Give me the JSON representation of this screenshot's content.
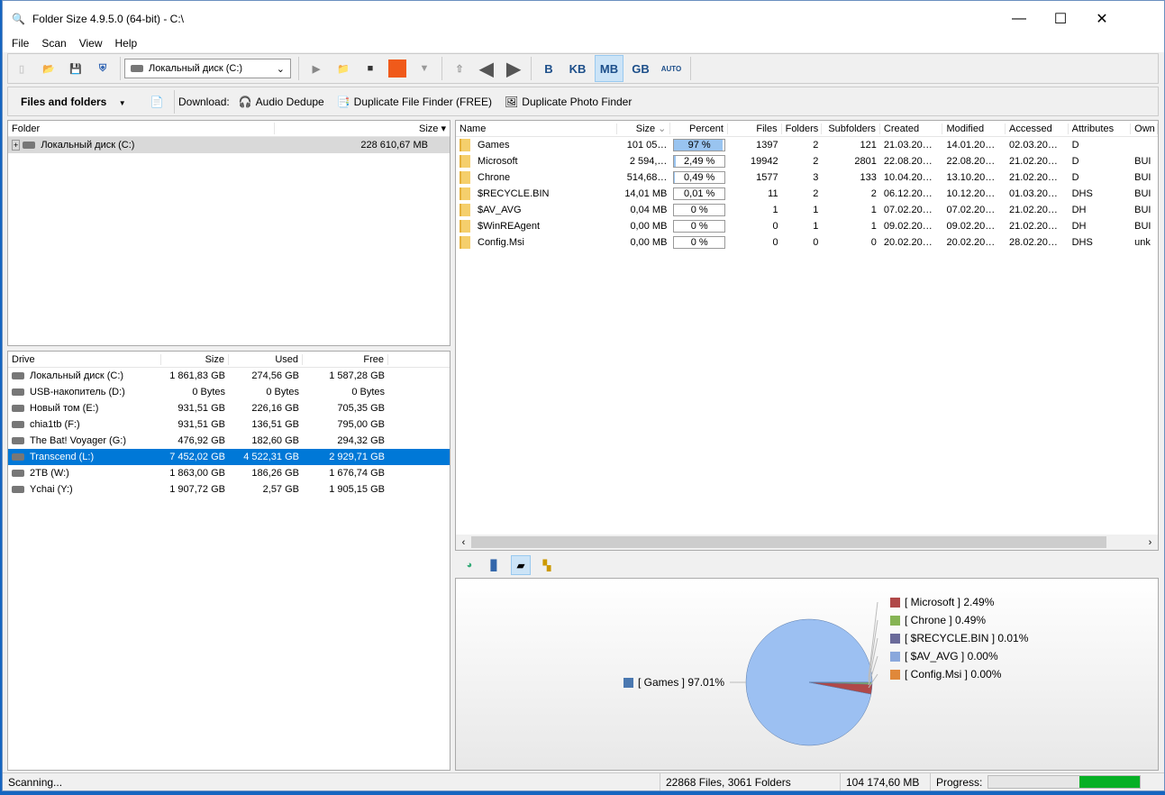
{
  "title": "Folder Size 4.9.5.0 (64-bit) - C:\\",
  "window_controls": {
    "min": "—",
    "max": "☐",
    "close": "✕"
  },
  "menu": [
    "File",
    "Scan",
    "View",
    "Help"
  ],
  "toolbar": {
    "drive_select": "Локальный диск (C:)",
    "units": [
      "B",
      "KB",
      "MB",
      "GB",
      "AUTO"
    ],
    "active_unit": "MB"
  },
  "toolbar2": {
    "view": "Files and folders",
    "download": "Download:",
    "links": [
      "Audio Dedupe",
      "Duplicate File Finder (FREE)",
      "Duplicate Photo Finder"
    ]
  },
  "tree": {
    "headers": [
      "Folder",
      "Size"
    ],
    "rows": [
      {
        "name": "Локальный диск (C:)",
        "size": "228 610,67 MB"
      }
    ]
  },
  "drives": {
    "headers": [
      "Drive",
      "Size",
      "Used",
      "Free"
    ],
    "rows": [
      [
        "Локальный диск (C:)",
        "1 861,83 GB",
        "274,56 GB",
        "1 587,28 GB"
      ],
      [
        "USB-накопитель (D:)",
        "0 Bytes",
        "0 Bytes",
        "0 Bytes"
      ],
      [
        "Новый том (E:)",
        "931,51 GB",
        "226,16 GB",
        "705,35 GB"
      ],
      [
        "chia1tb (F:)",
        "931,51 GB",
        "136,51 GB",
        "795,00 GB"
      ],
      [
        "The Bat! Voyager (G:)",
        "476,92 GB",
        "182,60 GB",
        "294,32 GB"
      ],
      [
        "Transcend (L:)",
        "7 452,02 GB",
        "4 522,31 GB",
        "2 929,71 GB"
      ],
      [
        "2TB (W:)",
        "1 863,00 GB",
        "186,26 GB",
        "1 676,74 GB"
      ],
      [
        "Ychai (Y:)",
        "1 907,72 GB",
        "2,57 GB",
        "1 905,15 GB"
      ]
    ],
    "selected": 5
  },
  "files": {
    "headers": [
      "Name",
      "Size",
      "Percent",
      "Files",
      "Folders",
      "Subfolders",
      "Created",
      "Modified",
      "Accessed",
      "Attributes",
      "Own"
    ],
    "rows": [
      {
        "c": [
          "Games",
          "101 05…",
          "97 %",
          "1397",
          "2",
          "121",
          "21.03.20…",
          "14.01.20…",
          "02.03.20…",
          "D",
          ""
        ],
        "pct": 97
      },
      {
        "c": [
          "Microsoft",
          "2 594,…",
          "2,49 %",
          "19942",
          "2",
          "2801",
          "22.08.20…",
          "22.08.20…",
          "21.02.20…",
          "D",
          "BUI"
        ],
        "pct": 2.49
      },
      {
        "c": [
          "Chrone",
          "514,68…",
          "0,49 %",
          "1577",
          "3",
          "133",
          "10.04.20…",
          "13.10.20…",
          "21.02.20…",
          "D",
          "BUI"
        ],
        "pct": 0.49
      },
      {
        "c": [
          "$RECYCLE.BIN",
          "14,01 MB",
          "0,01 %",
          "11",
          "2",
          "2",
          "06.12.20…",
          "10.12.20…",
          "01.03.20…",
          "DHS",
          "BUI"
        ],
        "pct": 0.01
      },
      {
        "c": [
          "$AV_AVG",
          "0,04 MB",
          "0 %",
          "1",
          "1",
          "1",
          "07.02.20…",
          "07.02.20…",
          "21.02.20…",
          "DH",
          "BUI"
        ],
        "pct": 0
      },
      {
        "c": [
          "$WinREAgent",
          "0,00 MB",
          "0 %",
          "0",
          "1",
          "1",
          "09.02.20…",
          "09.02.20…",
          "21.02.20…",
          "DH",
          "BUI"
        ],
        "pct": 0
      },
      {
        "c": [
          "Config.Msi",
          "0,00 MB",
          "0 %",
          "0",
          "0",
          "0",
          "20.02.20…",
          "20.02.20…",
          "28.02.20…",
          "DHS",
          "unk"
        ],
        "pct": 0
      }
    ]
  },
  "chart_data": {
    "type": "pie",
    "slices": [
      {
        "label": "[ Games ] 97.01%",
        "value": 97.01,
        "color": "#4a78b0"
      },
      {
        "label": "[ Microsoft ] 2.49%",
        "value": 2.49,
        "color": "#b04848"
      },
      {
        "label": "[ Chrone ] 0.49%",
        "value": 0.49,
        "color": "#86b454"
      },
      {
        "label": "[ $RECYCLE.BIN ] 0.01%",
        "value": 0.01,
        "color": "#6a6a9a"
      },
      {
        "label": "[ $AV_AVG ] 0.00%",
        "value": 0,
        "color": "#8aa8dc"
      },
      {
        "label": "[ Config.Msi ] 0.00%",
        "value": 0,
        "color": "#e0883a"
      }
    ]
  },
  "status": {
    "text": "Scanning...",
    "counts": "22868 Files, 3061 Folders",
    "total": "104 174,60 MB",
    "progress_label": "Progress:",
    "progress": 0.4
  }
}
